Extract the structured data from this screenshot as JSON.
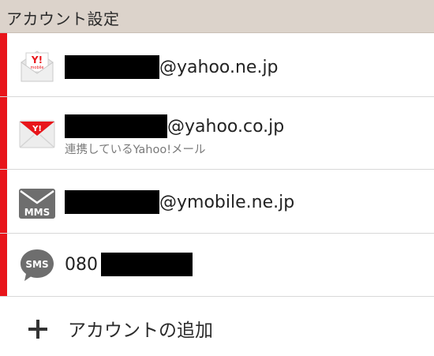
{
  "header": {
    "title": "アカウント設定"
  },
  "accounts": [
    {
      "id": "yahoo-ne-jp",
      "icon": "yahoo-mobile-mail-icon",
      "primary_suffix": "@yahoo.ne.jp",
      "secondary": ""
    },
    {
      "id": "yahoo-co-jp",
      "icon": "yahoo-mail-icon",
      "primary_suffix": "@yahoo.co.jp",
      "secondary": "連携しているYahoo!メール"
    },
    {
      "id": "ymobile-ne-jp",
      "icon": "mms-icon",
      "icon_label": "MMS",
      "primary_suffix": "@ymobile.ne.jp",
      "secondary": ""
    },
    {
      "id": "sms",
      "icon": "sms-icon",
      "icon_label": "SMS",
      "primary_prefix": "080",
      "secondary": ""
    }
  ],
  "add_account": {
    "label": "アカウントの追加",
    "icon": "plus-icon"
  },
  "colors": {
    "accent": "#e8151a",
    "header_bg": "#dcd3cb",
    "icon_gray": "#6e6e6e"
  }
}
